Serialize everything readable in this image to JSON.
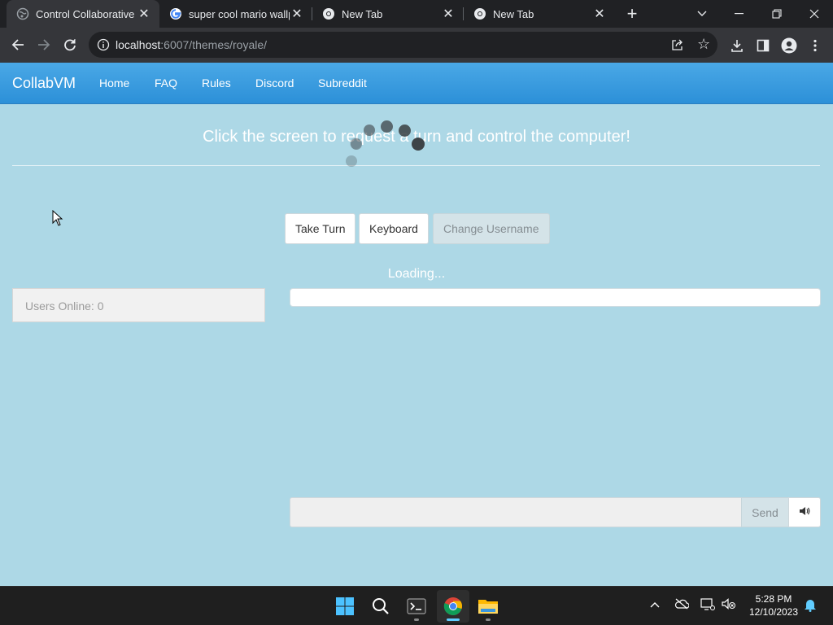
{
  "browser": {
    "tabs": [
      {
        "title": "Control Collaborative V",
        "favicon": "globe-icon",
        "active": true
      },
      {
        "title": "super cool mario wallp",
        "favicon": "google-icon",
        "active": false
      },
      {
        "title": "New Tab",
        "favicon": "chrome-icon",
        "active": false
      },
      {
        "title": "New Tab",
        "favicon": "chrome-icon",
        "active": false
      }
    ],
    "url": {
      "host": "localhost",
      "rest": ":6007/themes/royale/"
    }
  },
  "site": {
    "brand": "CollabVM",
    "nav": [
      "Home",
      "FAQ",
      "Rules",
      "Discord",
      "Subreddit"
    ]
  },
  "main": {
    "prompt": "Click the screen to request a turn and control the computer!",
    "buttons": {
      "take_turn": "Take Turn",
      "keyboard": "Keyboard",
      "change_username": "Change Username"
    },
    "loading": "Loading...",
    "users_online": "Users Online: 0",
    "chat": {
      "placeholder": "",
      "send": "Send"
    }
  },
  "taskbar": {
    "apps": [
      "windows-start-icon",
      "search-icon",
      "terminal-icon",
      "chrome-icon",
      "file-explorer-icon"
    ],
    "time": "5:28 PM",
    "date": "12/10/2023"
  },
  "colors": {
    "page_bg": "#add8e6",
    "navbar": "#2c90d8",
    "accent": "#60cdff"
  }
}
